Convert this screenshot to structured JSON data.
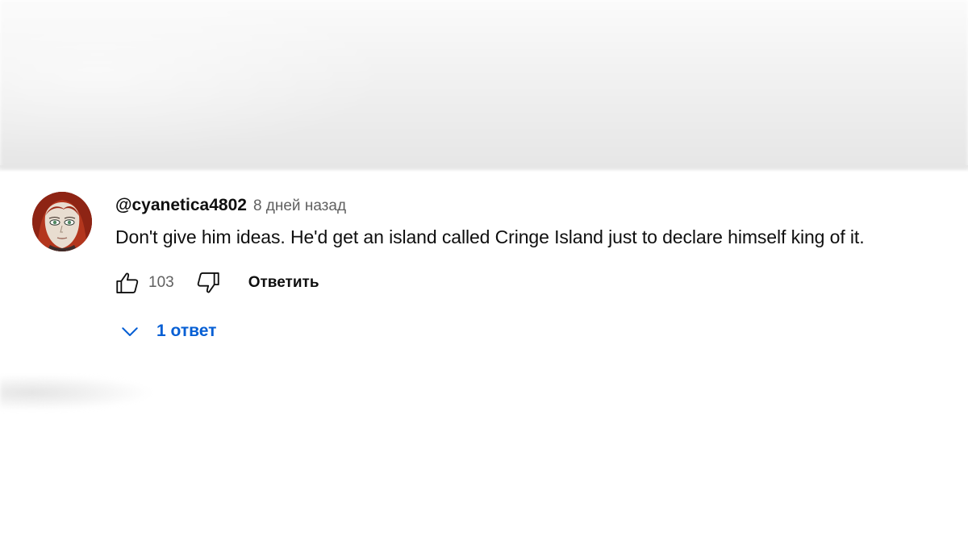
{
  "comment": {
    "author": "@cyanetica4802",
    "time": "8 дней назад",
    "text": "Don't give him ideas. He'd get an island called Cringe Island just to declare himself king of it.",
    "like_count": "103",
    "reply_label": "Ответить",
    "replies_label": "1 ответ"
  },
  "icons": {
    "like": "thumbs-up-icon",
    "dislike": "thumbs-down-icon",
    "expand": "chevron-down-icon"
  },
  "colors": {
    "link_blue": "#065fd4",
    "secondary_text": "#606060",
    "primary_text": "#0f0f0f"
  }
}
